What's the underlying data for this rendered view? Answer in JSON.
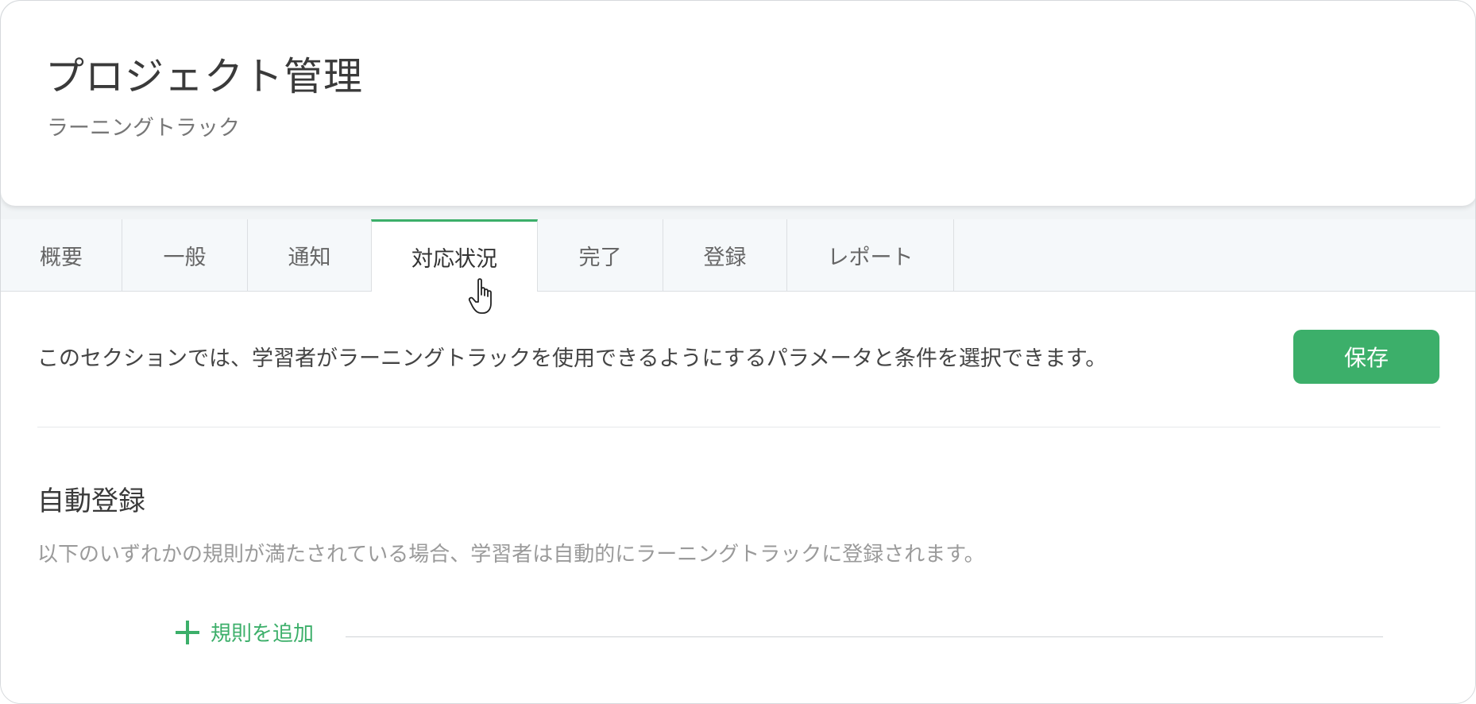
{
  "header": {
    "title": "プロジェクト管理",
    "subtitle": "ラーニングトラック"
  },
  "tabs": [
    {
      "label": "概要",
      "active": false
    },
    {
      "label": "一般",
      "active": false
    },
    {
      "label": "通知",
      "active": false
    },
    {
      "label": "対応状況",
      "active": true
    },
    {
      "label": "完了",
      "active": false
    },
    {
      "label": "登録",
      "active": false
    },
    {
      "label": "レポート",
      "active": false
    }
  ],
  "content": {
    "description": "このセクションでは、学習者がラーニングトラックを使用できるようにするパラメータと条件を選択できます。",
    "save_label": "保存",
    "section_title": "自動登録",
    "section_description": "以下のいずれかの規則が満たされている場合、学習者は自動的にラーニングトラックに登録されます。",
    "add_rule_label": "規則を追加"
  },
  "colors": {
    "accent": "#3caf6a",
    "tab_bar_bg": "#f5f8fa"
  },
  "icons": {
    "add_rule": "plus-icon",
    "cursor": "hand-pointer-icon"
  }
}
